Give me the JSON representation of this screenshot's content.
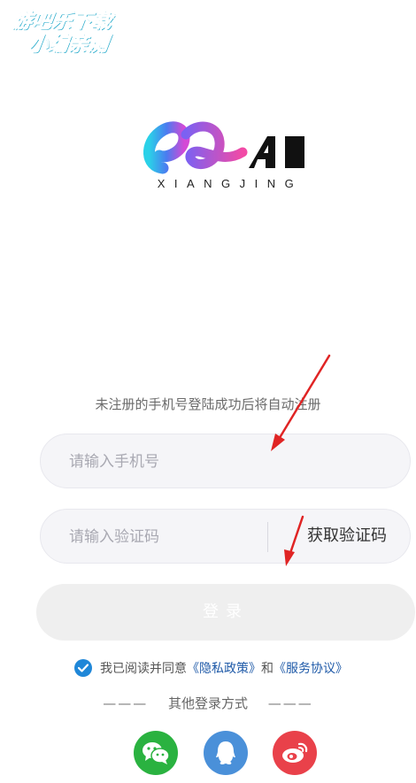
{
  "watermark": {
    "line1": "游吧乐下载",
    "line2": "小编亲测"
  },
  "logo": {
    "brand_text": "XIANGJING",
    "ai_letters": "AI"
  },
  "hint": "未注册的手机号登陆成功后将自动注册",
  "phone_field": {
    "placeholder": "请输入手机号",
    "value": ""
  },
  "code_field": {
    "placeholder": "请输入验证码",
    "value": "",
    "get_code_label": "获取验证码"
  },
  "login_button_label": "登录",
  "agreement": {
    "checked": true,
    "prefix": "我已阅读并同意",
    "privacy_link": "《隐私政策》",
    "and_text": "和",
    "service_link": "《服务协议》"
  },
  "other_login": {
    "dash_left": "———",
    "label": "其他登录方式",
    "dash_right": "———",
    "methods": [
      "wechat-icon",
      "qq-icon",
      "weibo-icon"
    ]
  },
  "colors": {
    "primary_blue": "#1f87d8",
    "wechat": "#2ab240",
    "qq": "#4a90d9",
    "weibo": "#e9414a",
    "annotation_arrow": "#e02424"
  }
}
